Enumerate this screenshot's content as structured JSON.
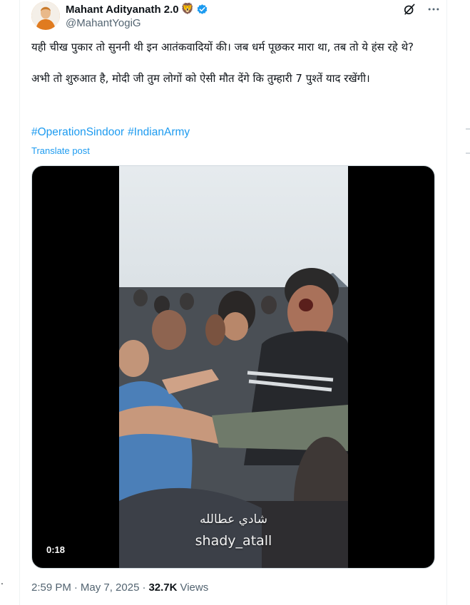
{
  "author": {
    "display_name": "Mahant Adityanath 2.0",
    "emoji": "🦁",
    "handle": "@MahantYogiG"
  },
  "post": {
    "paragraph_1": "यही चीख पुकार तो सुननी थी इन आतंकवादियों की। जब धर्म पूछकर मारा था, तब तो ये हंस रहे थे?",
    "paragraph_2": "अभी तो शुरुआत है, मोदी जी तुम लोगों को ऐसी मौत देंगे कि तुम्हारी 7 पुश्तें याद रखेंगी।",
    "hashtags": [
      "#OperationSindoor",
      "#IndianArmy"
    ],
    "translate_label": "Translate post"
  },
  "media": {
    "duration": "0:18",
    "overlay_arabic": "شادي عطالله",
    "overlay_handle": "shady_atall"
  },
  "meta": {
    "time": "2:59 PM",
    "separator": "·",
    "date": "May 7, 2025",
    "views_count": "32.7K",
    "views_label": "Views"
  },
  "page": {
    "stray_dot": "."
  },
  "icons": {
    "grok": "grok-icon",
    "more": "more-options-icon",
    "verified": "verified-badge-icon"
  },
  "colors": {
    "link": "#1d9bf0",
    "secondary_text": "#536471",
    "primary_text": "#0f1419",
    "verified": "#1d9bf0"
  }
}
